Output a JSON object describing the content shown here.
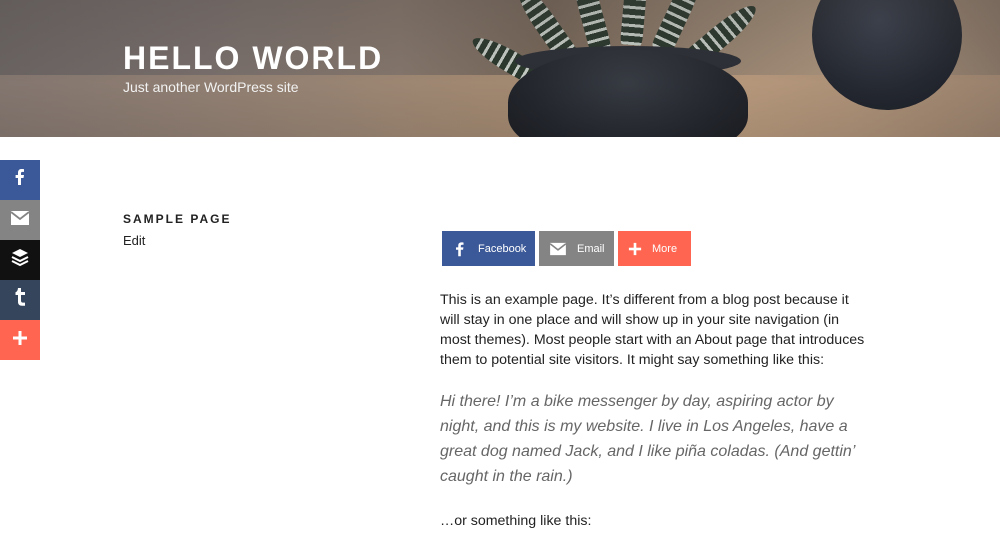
{
  "site": {
    "title": "HELLO WORLD",
    "tagline": "Just another WordPress site"
  },
  "sidebar_share": [
    {
      "name": "facebook",
      "icon": "facebook-icon",
      "color": "#3b5998"
    },
    {
      "name": "email",
      "icon": "email-icon",
      "color": "#848484"
    },
    {
      "name": "buffer",
      "icon": "buffer-icon",
      "color": "#111111"
    },
    {
      "name": "tumblr",
      "icon": "tumblr-icon",
      "color": "#35465c"
    },
    {
      "name": "more",
      "icon": "plus-icon",
      "color": "#ff6550"
    }
  ],
  "page": {
    "title": "SAMPLE PAGE",
    "edit_label": "Edit"
  },
  "share_buttons": {
    "facebook_label": "Facebook",
    "email_label": "Email",
    "more_label": "More"
  },
  "content": {
    "intro": "This is an example page. It’s different from a blog post because it will stay in one place and will show up in your site navigation (in most themes). Most people start with an About page that introduces them to potential site visitors. It might say something like this:",
    "quote": "Hi there! I’m a bike messenger by day, aspiring actor by night, and this is my website. I live in Los Angeles, have a great dog named Jack, and I like piña coladas. (And gettin’ caught in the rain.)",
    "outro": "…or something like this:"
  }
}
